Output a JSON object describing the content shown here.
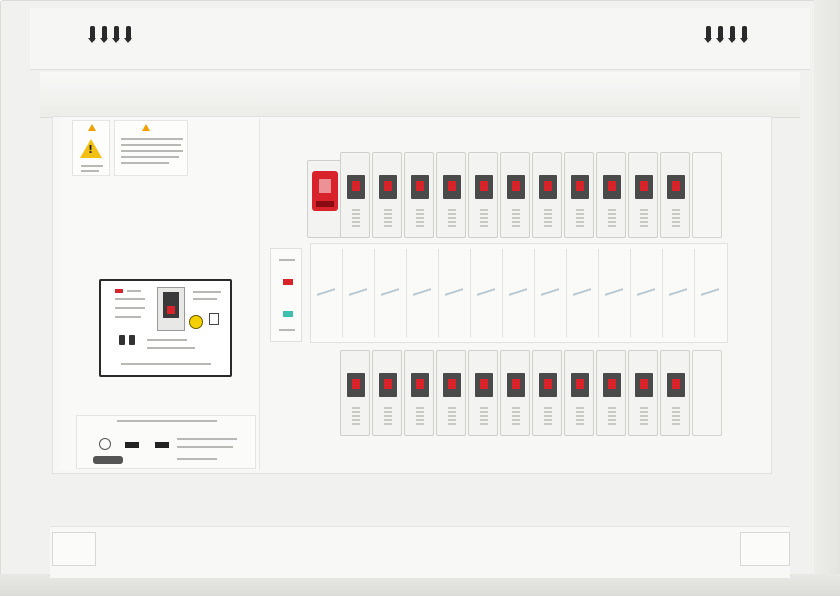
{
  "image": {
    "subject": "",
    "colors": {
      "panel": "#f1f1ef",
      "breaker_body": "#f3f3f1",
      "indicator_red": "#d8232a",
      "warning_yellow": "#f2c012",
      "window_dark": "#4a4a4a"
    }
  },
  "top_vents": [
    "vent-icon",
    "vent-icon"
  ],
  "upper_breakers": {
    "handle_count": 11,
    "blank_slots": 1,
    "main_handle_color": "#d8232a"
  },
  "lower_breakers": {
    "handle_count": 11,
    "blank_slots": 1
  },
  "warning_labels": [
    "warning-triangle-icon",
    "warning-triangle-icon"
  ],
  "main_breaker": {
    "icons": [
      "red-marker-icon",
      "test-button-icon",
      "toggle-handle-icon"
    ]
  }
}
